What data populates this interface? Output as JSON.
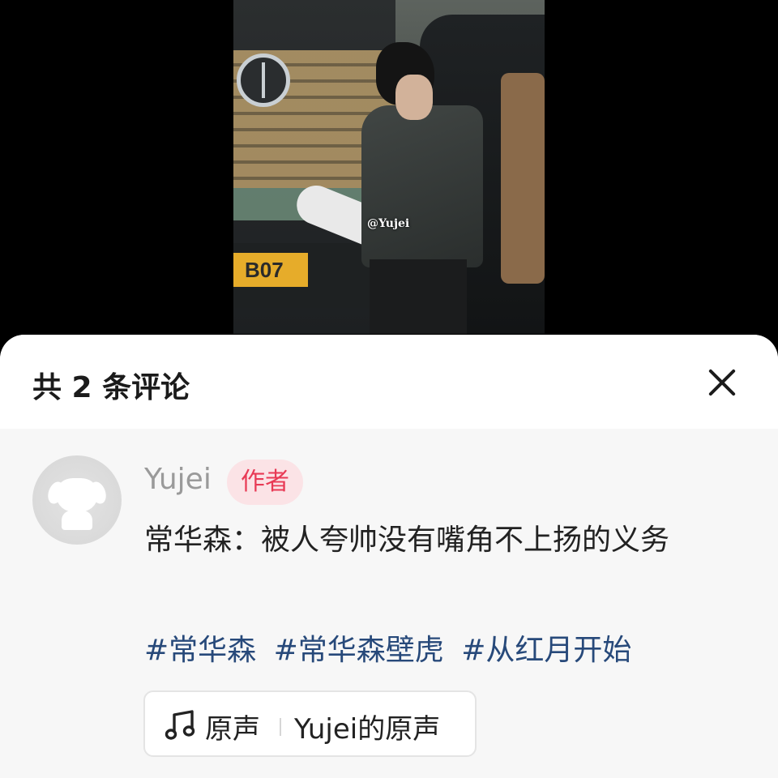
{
  "video": {
    "watermark": "@Yujei",
    "plate_text": "B07"
  },
  "sheet": {
    "title": "共 2 条评论",
    "close_icon": "close-icon"
  },
  "comment": {
    "username": "Yujei",
    "badge": "作者",
    "text": "常华森：被人夸帅没有嘴角不上扬的义务",
    "hashtags": [
      "#常华森",
      "#常华森壁虎",
      "#从红月开始"
    ],
    "music": {
      "icon": "music-note-icon",
      "label": "原声",
      "name": "Yujei的原声"
    }
  },
  "colors": {
    "badge_bg": "#fbe3e6",
    "badge_text": "#e83a55",
    "hashtag": "#27497a",
    "username": "#9a9a9a"
  }
}
